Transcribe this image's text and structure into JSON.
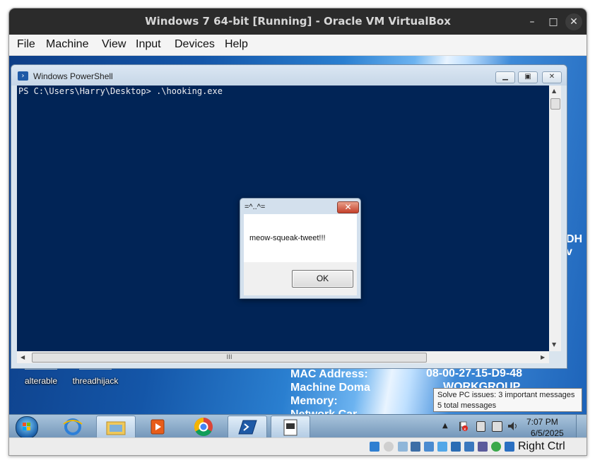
{
  "vbox": {
    "title": "Windows 7 64-bit [Running] - Oracle VM VirtualBox",
    "minimize_glyph": "–",
    "maximize_glyph": "□",
    "close_glyph": "✕",
    "menu": [
      "File",
      "Machine",
      "View",
      "Input",
      "Devices",
      "Help"
    ],
    "host_key": "Right Ctrl"
  },
  "desktop": {
    "icons": [
      {
        "label": "alterable"
      },
      {
        "label": "threadhijack"
      }
    ],
    "sysinfo_lines": [
      "MAC Address:",
      "Machine Doma",
      "Memory:",
      "Network Car"
    ],
    "mac_value": "08-00-27-15-D9-48",
    "workgroup_value": "WORKGROUP",
    "side_text": "DH v"
  },
  "powershell": {
    "title": "Windows PowerShell",
    "prompt_line": "PS C:\\Users\\Harry\\Desktop> .\\hooking.exe",
    "hscroll_grip": "III"
  },
  "msgbox": {
    "title": "=^..^=",
    "message": "meow-squeak-tweet!!!",
    "ok_label": "OK",
    "close_glyph": "✕"
  },
  "tooltip": {
    "line1": "Solve PC issues: 3 important messages",
    "line2": "5 total messages"
  },
  "taskbar": {
    "time": "7:07 PM",
    "date": "6/5/2025",
    "tray_arrow": "▲"
  },
  "colors": {
    "console_bg": "#012456",
    "vbox_titlebar": "#2b2b2b",
    "desktop_blue": "#1d62b6"
  }
}
